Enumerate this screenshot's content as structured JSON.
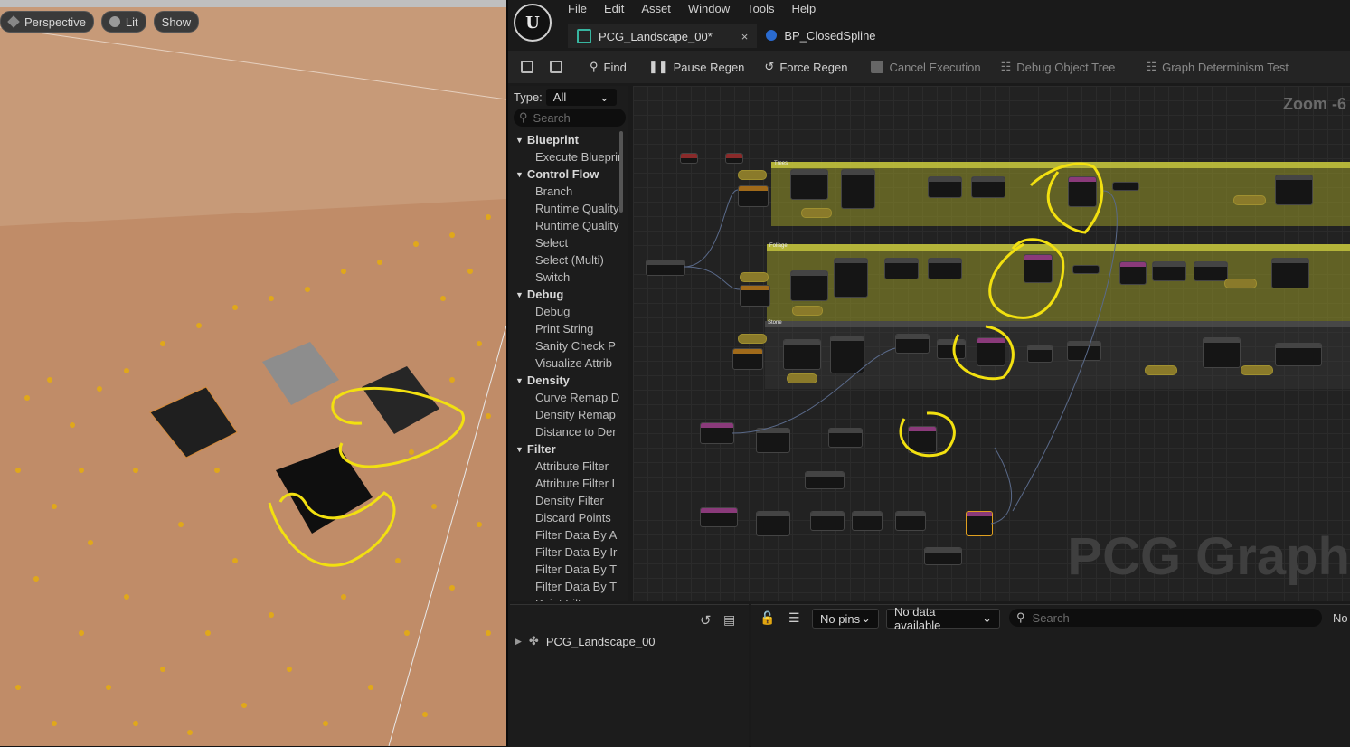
{
  "viewport": {
    "buttons": [
      {
        "label": "Perspective",
        "icon": "cube-icon"
      },
      {
        "label": "Lit",
        "icon": "circle-icon"
      },
      {
        "label": "Show"
      }
    ]
  },
  "menu": {
    "items": [
      "File",
      "Edit",
      "Asset",
      "Window",
      "Tools",
      "Help"
    ]
  },
  "tabs": [
    {
      "label": "PCG_Landscape_00*",
      "close": "×"
    },
    {
      "label": "BP_ClosedSpline"
    }
  ],
  "toolbar": {
    "find": "Find",
    "pause_regen": "Pause Regen",
    "force_regen": "Force Regen",
    "cancel_execution": "Cancel Execution",
    "debug_object_tree": "Debug Object Tree",
    "graph_determinism_test": "Graph Determinism Test"
  },
  "palette": {
    "type_label": "Type:",
    "type_value": "All",
    "search_placeholder": "Search",
    "rows": [
      {
        "kind": "cat",
        "label": "Blueprint"
      },
      {
        "kind": "item",
        "label": "Execute Blueprint"
      },
      {
        "kind": "cat",
        "label": "Control Flow"
      },
      {
        "kind": "item",
        "label": "Branch"
      },
      {
        "kind": "item",
        "label": "Runtime Quality"
      },
      {
        "kind": "item",
        "label": "Runtime Quality"
      },
      {
        "kind": "item",
        "label": "Select"
      },
      {
        "kind": "item",
        "label": "Select (Multi)"
      },
      {
        "kind": "item",
        "label": "Switch"
      },
      {
        "kind": "cat",
        "label": "Debug"
      },
      {
        "kind": "item",
        "label": "Debug"
      },
      {
        "kind": "item",
        "label": "Print String"
      },
      {
        "kind": "item",
        "label": "Sanity Check P"
      },
      {
        "kind": "item",
        "label": "Visualize Attrib"
      },
      {
        "kind": "cat",
        "label": "Density"
      },
      {
        "kind": "item",
        "label": "Curve Remap D"
      },
      {
        "kind": "item",
        "label": "Density Remap"
      },
      {
        "kind": "item",
        "label": "Distance to Der"
      },
      {
        "kind": "cat",
        "label": "Filter"
      },
      {
        "kind": "item",
        "label": "Attribute Filter"
      },
      {
        "kind": "item",
        "label": "Attribute Filter I"
      },
      {
        "kind": "item",
        "label": "Density Filter"
      },
      {
        "kind": "item",
        "label": "Discard Points"
      },
      {
        "kind": "item",
        "label": "Filter Data By A"
      },
      {
        "kind": "item",
        "label": "Filter Data By Ir"
      },
      {
        "kind": "item",
        "label": "Filter Data By T"
      },
      {
        "kind": "item",
        "label": "Filter Data By T"
      },
      {
        "kind": "item",
        "label": "Point Filter"
      }
    ]
  },
  "graph": {
    "zoom_text": "Zoom -6",
    "watermark": "PCG Graph",
    "comments": [
      "Trees",
      "Foliage",
      "Stone"
    ]
  },
  "bottom": {
    "tree_item": "PCG_Landscape_00",
    "pins_dropdown": "No pins",
    "data_dropdown": "No data available",
    "search_placeholder": "Search",
    "right_text": "No"
  }
}
